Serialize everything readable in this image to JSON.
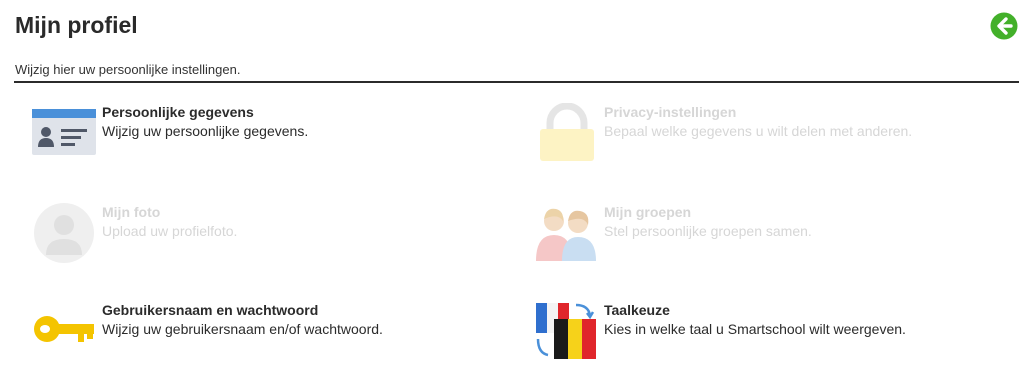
{
  "header": {
    "title": "Mijn profiel",
    "subtitle": "Wijzig hier uw persoonlijke instellingen."
  },
  "items": [
    {
      "title": "Persoonlijke gegevens",
      "description": "Wijzig uw persoonlijke gegevens.",
      "icon": "id-card-icon",
      "enabled": true
    },
    {
      "title": "Privacy-instellingen",
      "description": "Bepaal welke gegevens u wilt delen met anderen.",
      "icon": "lock-icon",
      "enabled": false
    },
    {
      "title": "Mijn foto",
      "description": "Upload uw profielfoto.",
      "icon": "user-silhouette-icon",
      "enabled": false
    },
    {
      "title": "Mijn groepen",
      "description": "Stel persoonlijke groepen samen.",
      "icon": "group-icon",
      "enabled": false
    },
    {
      "title": "Gebruikersnaam en wachtwoord",
      "description": "Wijzig uw gebruikersnaam en/of wachtwoord.",
      "icon": "key-icon",
      "enabled": true
    },
    {
      "title": "Taalkeuze",
      "description": "Kies in welke taal u Smartschool wilt weergeven.",
      "icon": "language-flags-icon",
      "enabled": true
    }
  ],
  "colors": {
    "back_button": "#43b02a",
    "key": "#f4c400",
    "id_card": "#4a90d9",
    "disabled_text": "#d6d6d6"
  }
}
